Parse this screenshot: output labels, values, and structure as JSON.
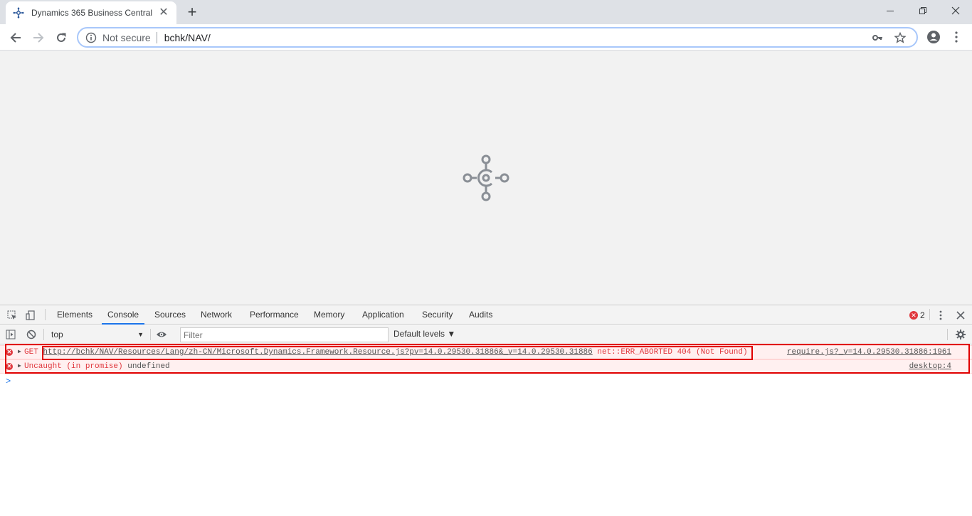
{
  "browser": {
    "tab_title": "Dynamics 365 Business Central",
    "tab_close": "✕",
    "new_tab": "+",
    "security_label": "Not secure",
    "url": "bchk/NAV/"
  },
  "devtools": {
    "tabs": [
      "Elements",
      "Console",
      "Sources",
      "Network",
      "Performance",
      "Memory",
      "Application",
      "Security",
      "Audits"
    ],
    "active_tab": "Console",
    "error_count": "2",
    "context": "top",
    "filter_placeholder": "Filter",
    "levels": "Default levels ▼"
  },
  "console": {
    "messages": [
      {
        "method": "GET",
        "url": "http://bchk/NAV/Resources/Lang/zh-CN/Microsoft.Dynamics.Framework.Resource.js?pv=14.0.29530.31886&_v=14.0.29530.31886",
        "error": "net::ERR_ABORTED 404 (Not Found)",
        "source": "require.js?_v=14.0.29530.31886:1961"
      },
      {
        "text": "Uncaught (in promise)",
        "detail": "undefined",
        "source": "desktop:4"
      }
    ],
    "prompt": ">"
  },
  "colors": {
    "error": "#e0383e",
    "accent": "#1a73e8",
    "highlight_box": "#e00000"
  }
}
